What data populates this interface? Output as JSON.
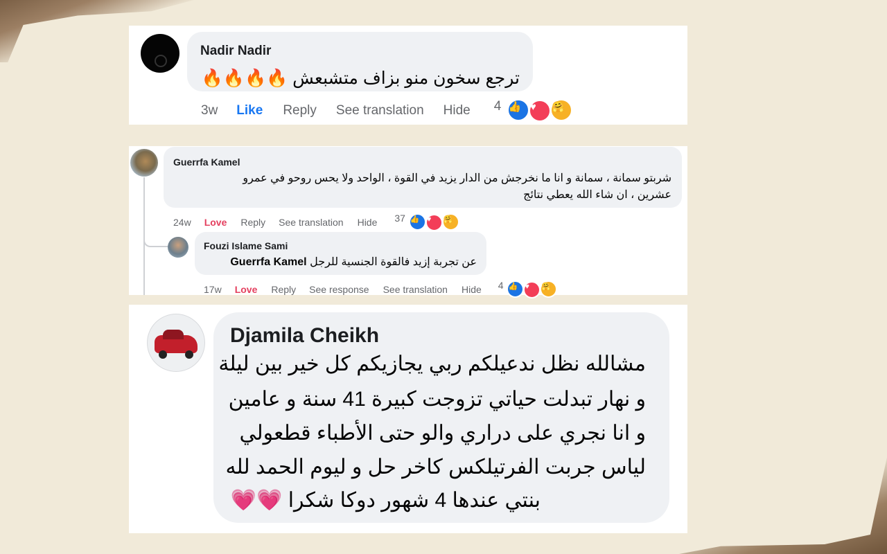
{
  "comments": [
    {
      "author": "Nadir Nadir",
      "text": "ترجع سخون منو بزاف متشبعش 🔥🔥🔥🔥",
      "actions": {
        "time": "3w",
        "react": "Like",
        "reply": "Reply",
        "translate": "See translation",
        "hide": "Hide"
      },
      "reaction_count": "4"
    },
    {
      "author": "Guerrfa Kamel",
      "text_line1": "شربتو سمانة ، سمانة و انا ما نخرجش من الدار يزيد في القوة ، الواحد ولا يحس روحو في عمرو",
      "text_line2": "عشرين ، ان شاء الله يعطي نتائج",
      "actions": {
        "time": "24w",
        "react": "Love",
        "reply": "Reply",
        "translate": "See translation",
        "hide": "Hide"
      },
      "reaction_count": "37",
      "reply": {
        "author": "Fouzi Islame Sami",
        "mention": "Guerrfa Kamel",
        "text": "عن تجربة إزيد فالقوة الجنسية للرجل",
        "actions": {
          "time": "17w",
          "react": "Love",
          "reply": "Reply",
          "see_response": "See response",
          "translate": "See translation",
          "hide": "Hide"
        },
        "reaction_count": "4"
      }
    },
    {
      "author": "Djamila Cheikh",
      "lines": [
        "مشالله نظل ندعيلكم ربي يجازيكم كل خير بين ليلة",
        "و نهار تبدلت حياتي تزوجت كبيرة 41 سنة و عامين",
        "و انا نجري على دراري والو حتى الأطباء قطعولي",
        "لياس جربت الفرتيلكس كاخر حل و ليوم الحمد لله",
        "بنتي عندها 4 شهور دوكا شكرا 💗💗"
      ]
    }
  ],
  "icons": {
    "like": "thumbs-up-icon",
    "love": "heart-icon",
    "care": "care-hug-icon"
  },
  "colors": {
    "like_blue": "#1877f2",
    "love_red": "#e4405f",
    "bubble": "#eff1f4",
    "background": "#f1ead9"
  }
}
